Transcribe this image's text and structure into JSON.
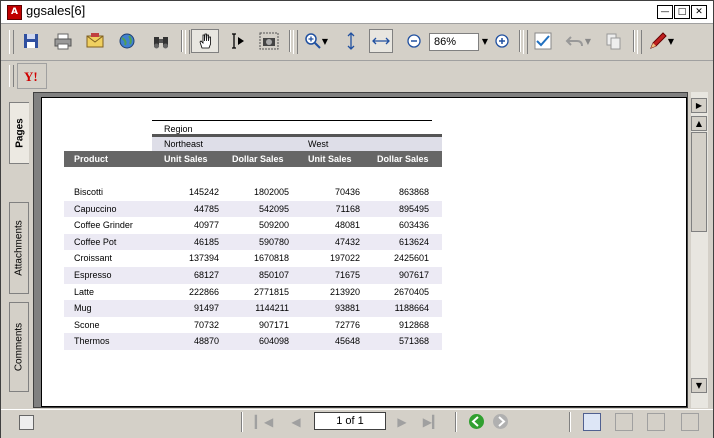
{
  "window": {
    "title": "ggsales[6]"
  },
  "toolbar": {
    "zoom_value": "86%"
  },
  "side_tabs": [
    "Pages",
    "Attachments",
    "Comments"
  ],
  "report": {
    "group_label": "Region",
    "regions": [
      "Northeast",
      "West"
    ],
    "columns": [
      "Product",
      "Unit Sales",
      "Dollar Sales",
      "Unit Sales",
      "Dollar Sales"
    ],
    "rows": [
      [
        "Biscotti",
        "145242",
        "1802005",
        "70436",
        "863868"
      ],
      [
        "Capuccino",
        "44785",
        "542095",
        "71168",
        "895495"
      ],
      [
        "Coffee Grinder",
        "40977",
        "509200",
        "48081",
        "603436"
      ],
      [
        "Coffee Pot",
        "46185",
        "590780",
        "47432",
        "613624"
      ],
      [
        "Croissant",
        "137394",
        "1670818",
        "197022",
        "2425601"
      ],
      [
        "Espresso",
        "68127",
        "850107",
        "71675",
        "907617"
      ],
      [
        "Latte",
        "222866",
        "2771815",
        "213920",
        "2670405"
      ],
      [
        "Mug",
        "91497",
        "1144211",
        "93881",
        "1188664"
      ],
      [
        "Scone",
        "70732",
        "907171",
        "72776",
        "912868"
      ],
      [
        "Thermos",
        "48870",
        "604098",
        "45648",
        "571368"
      ]
    ]
  },
  "status": {
    "page_indicator": "1 of 1"
  }
}
